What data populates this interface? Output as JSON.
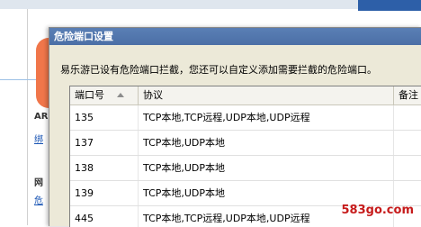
{
  "background": {
    "text_ar": "AR",
    "link1": "绑",
    "text_net": "网",
    "link2": "危"
  },
  "dialog": {
    "title": "危险端口设置",
    "description": "易乐游已设有危险端口拦截，您还可以自定义添加需要拦截的危险端口。",
    "table": {
      "headers": {
        "port": "端口号",
        "protocol": "协议",
        "note": "备注"
      },
      "rows": [
        {
          "port": "135",
          "protocol": "TCP本地,TCP远程,UDP本地,UDP远程"
        },
        {
          "port": "137",
          "protocol": "TCP本地,UDP本地"
        },
        {
          "port": "138",
          "protocol": "TCP本地,UDP本地"
        },
        {
          "port": "139",
          "protocol": "TCP本地,UDP本地"
        },
        {
          "port": "445",
          "protocol": "TCP本地,TCP远程,UDP本地,UDP远程"
        }
      ]
    }
  },
  "watermark": "583go.com",
  "colors": {
    "titlebar": "#4b6fa6",
    "dialog_bg": "#ece9d8",
    "accent_orange": "#f0764a",
    "watermark": "#c61b1b"
  }
}
